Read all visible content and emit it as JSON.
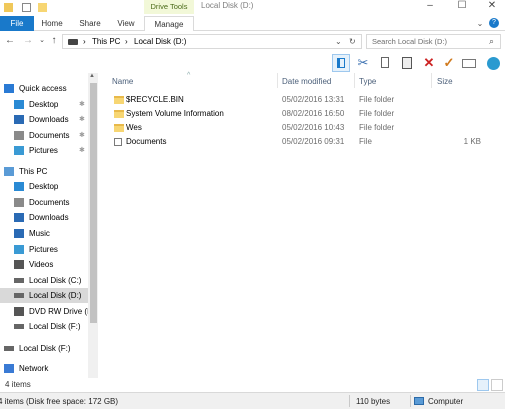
{
  "window": {
    "title": "Local Disk (D:)",
    "context_tab": "Drive Tools",
    "controls": [
      "–",
      "☐",
      "✕"
    ]
  },
  "ribbon": {
    "tabs": [
      "File",
      "Home",
      "Share",
      "View",
      "Manage"
    ]
  },
  "address": {
    "path": [
      "This PC",
      "Local Disk (D:)"
    ],
    "search_placeholder": "Search Local Disk (D:)"
  },
  "toolbar": {
    "icons": [
      "pane-view-icon",
      "cut-icon",
      "copy-icon",
      "paste-icon",
      "delete-icon",
      "checkmark-icon",
      "email-icon",
      "globe-icon"
    ]
  },
  "sidebar": {
    "items": [
      {
        "label": "Quick access",
        "icon": "star-icon",
        "indent": 0,
        "pinned": false
      },
      {
        "label": "Desktop",
        "icon": "desktop-icon",
        "indent": 1,
        "pinned": true
      },
      {
        "label": "Downloads",
        "icon": "download-icon",
        "indent": 1,
        "pinned": true
      },
      {
        "label": "Documents",
        "icon": "documents-icon",
        "indent": 1,
        "pinned": true
      },
      {
        "label": "Pictures",
        "icon": "pictures-icon",
        "indent": 1,
        "pinned": true
      },
      {
        "label": "This PC",
        "icon": "computer-icon",
        "indent": 0,
        "pinned": false
      },
      {
        "label": "Desktop",
        "icon": "desktop-icon",
        "indent": 1,
        "pinned": false
      },
      {
        "label": "Documents",
        "icon": "documents-icon",
        "indent": 1,
        "pinned": false
      },
      {
        "label": "Downloads",
        "icon": "download-icon",
        "indent": 1,
        "pinned": false
      },
      {
        "label": "Music",
        "icon": "music-icon",
        "indent": 1,
        "pinned": false
      },
      {
        "label": "Pictures",
        "icon": "pictures-icon",
        "indent": 1,
        "pinned": false
      },
      {
        "label": "Videos",
        "icon": "videos-icon",
        "indent": 1,
        "pinned": false
      },
      {
        "label": "Local Disk (C:)",
        "icon": "drive-icon",
        "indent": 1,
        "pinned": false
      },
      {
        "label": "Local Disk (D:)",
        "icon": "drive-icon",
        "indent": 1,
        "pinned": false,
        "selected": true
      },
      {
        "label": "DVD RW Drive (E",
        "icon": "dvd-icon",
        "indent": 1,
        "pinned": false
      },
      {
        "label": "Local Disk (F:)",
        "icon": "drive-icon",
        "indent": 1,
        "pinned": false
      },
      {
        "label": "Local Disk (F:)",
        "icon": "drive-icon",
        "indent": 0,
        "pinned": false
      },
      {
        "label": "Network",
        "icon": "network-icon",
        "indent": 0,
        "pinned": false
      }
    ]
  },
  "filelist": {
    "columns": [
      "Name",
      "Date modified",
      "Type",
      "Size"
    ],
    "rows": [
      {
        "name": "$RECYCLE.BIN",
        "date": "05/02/2016 13:31",
        "type": "File folder",
        "size": "",
        "icon": "folder-icon"
      },
      {
        "name": "System Volume Information",
        "date": "08/02/2016 16:50",
        "type": "File folder",
        "size": "",
        "icon": "folder-icon"
      },
      {
        "name": "Wes",
        "date": "05/02/2016 10:43",
        "type": "File folder",
        "size": "",
        "icon": "folder-icon"
      },
      {
        "name": "Documents",
        "date": "05/02/2016 09:31",
        "type": "File",
        "size": "1 KB",
        "icon": "file-icon"
      }
    ]
  },
  "status": {
    "items_count": "4 items"
  },
  "bottombar": {
    "details": "4 items (Disk free space: 172 GB)",
    "size": "110 bytes",
    "location": "Computer"
  },
  "colors": {
    "accent": "#1979ca",
    "selected": "#d9d9d9",
    "folder": "#f7d673",
    "delete": "#cc2222",
    "check": "#d07a1e"
  }
}
